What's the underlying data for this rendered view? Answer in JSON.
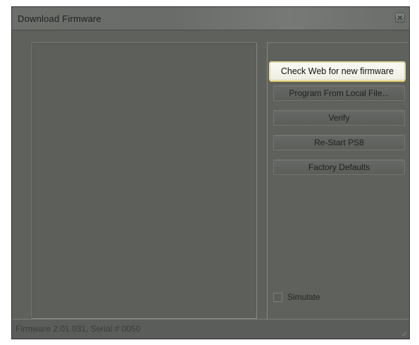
{
  "window": {
    "title": "Download Firmware",
    "close_icon": "close-icon"
  },
  "buttons": {
    "check_web": "Check Web for new firmware",
    "program_local": "Program From Local File...",
    "verify": "Verify",
    "restart": "Re-Start PS8",
    "factory_defaults": "Factory Defaults"
  },
  "simulate": {
    "label": "Simulate",
    "checked": false
  },
  "status": {
    "text": "Firmware 2.01.031, Serial # 0050"
  },
  "colors": {
    "background": "#5d5f5b",
    "highlight_button": "#fafaf4",
    "highlight_border": "#f3e49a"
  }
}
